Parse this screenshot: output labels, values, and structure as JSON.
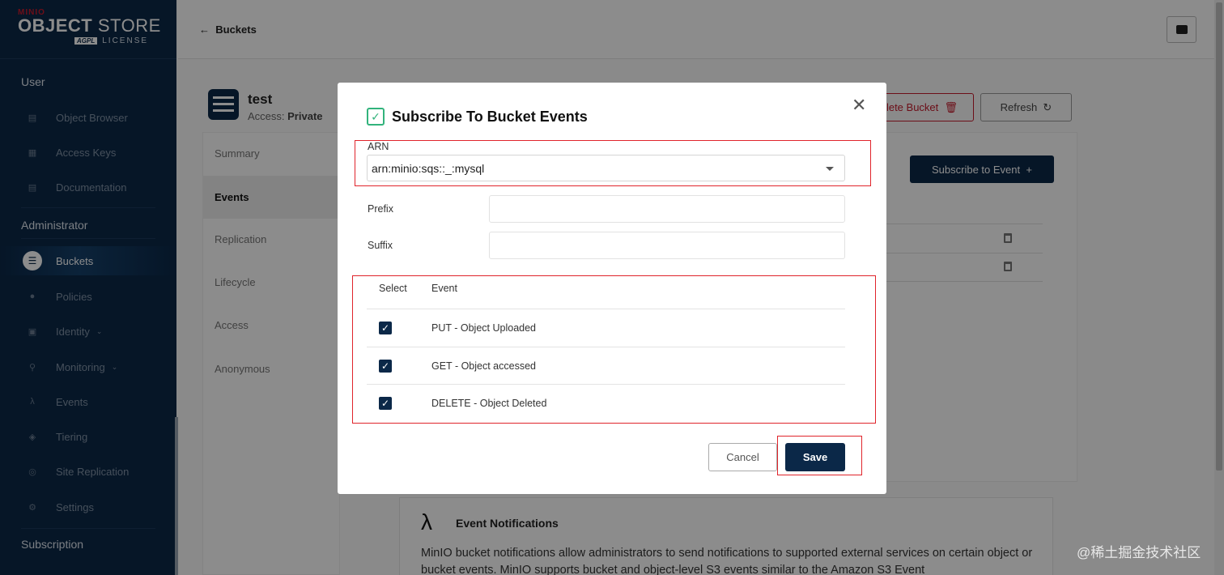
{
  "brand": {
    "small": "MINIO",
    "name_bold": "OBJECT",
    "name_light": " STORE",
    "badge": "AGPL",
    "license": "LICENSE"
  },
  "sidebar": {
    "sections": [
      "User",
      "Administrator",
      "Subscription"
    ],
    "user_items": [
      {
        "label": "Object Browser",
        "icon": "object-browser-icon"
      },
      {
        "label": "Access Keys",
        "icon": "access-keys-icon"
      },
      {
        "label": "Documentation",
        "icon": "documentation-icon"
      }
    ],
    "admin_items": [
      {
        "label": "Buckets",
        "icon": "buckets-icon",
        "active": true
      },
      {
        "label": "Policies",
        "icon": "policies-icon"
      },
      {
        "label": "Identity",
        "icon": "identity-icon",
        "has_chevron": true
      },
      {
        "label": "Monitoring",
        "icon": "monitoring-icon",
        "has_chevron": true
      },
      {
        "label": "Events",
        "icon": "lambda-icon"
      },
      {
        "label": "Tiering",
        "icon": "tiering-icon"
      },
      {
        "label": "Site Replication",
        "icon": "site-replication-icon"
      },
      {
        "label": "Settings",
        "icon": "settings-icon"
      }
    ]
  },
  "header": {
    "back_label": "Buckets"
  },
  "bucket": {
    "name": "test",
    "access_label": "Access:",
    "access_value": "Private",
    "delete_label": "lete Bucket",
    "refresh_label": "Refresh"
  },
  "tabs": [
    "Summary",
    "Events",
    "Replication",
    "Lifecycle",
    "Access",
    "Anonymous"
  ],
  "events_panel": {
    "subscribe_label": "Subscribe to Event"
  },
  "info": {
    "title": "Event Notifications",
    "text": "MinIO bucket notifications allow administrators to send notifications to supported external services on certain object or bucket events. MinIO supports bucket and object-level S3 events similar to the Amazon S3 Event"
  },
  "modal": {
    "title": "Subscribe To Bucket Events",
    "arn_label": "ARN",
    "arn_value": "arn:minio:sqs::_:mysql",
    "prefix_label": "Prefix",
    "prefix_value": "",
    "suffix_label": "Suffix",
    "suffix_value": "",
    "col_select": "Select",
    "col_event": "Event",
    "events": [
      {
        "label": "PUT - Object Uploaded",
        "checked": true
      },
      {
        "label": "GET - Object accessed",
        "checked": true
      },
      {
        "label": "DELETE - Object Deleted",
        "checked": true
      }
    ],
    "cancel_label": "Cancel",
    "save_label": "Save"
  },
  "watermark": "@稀土掘金技术社区",
  "colors": {
    "sidebar": "#0b2848",
    "accent": "#0b2848",
    "danger": "#c51a2c",
    "highlight_box": "#e0242b",
    "success": "#32b37c"
  }
}
